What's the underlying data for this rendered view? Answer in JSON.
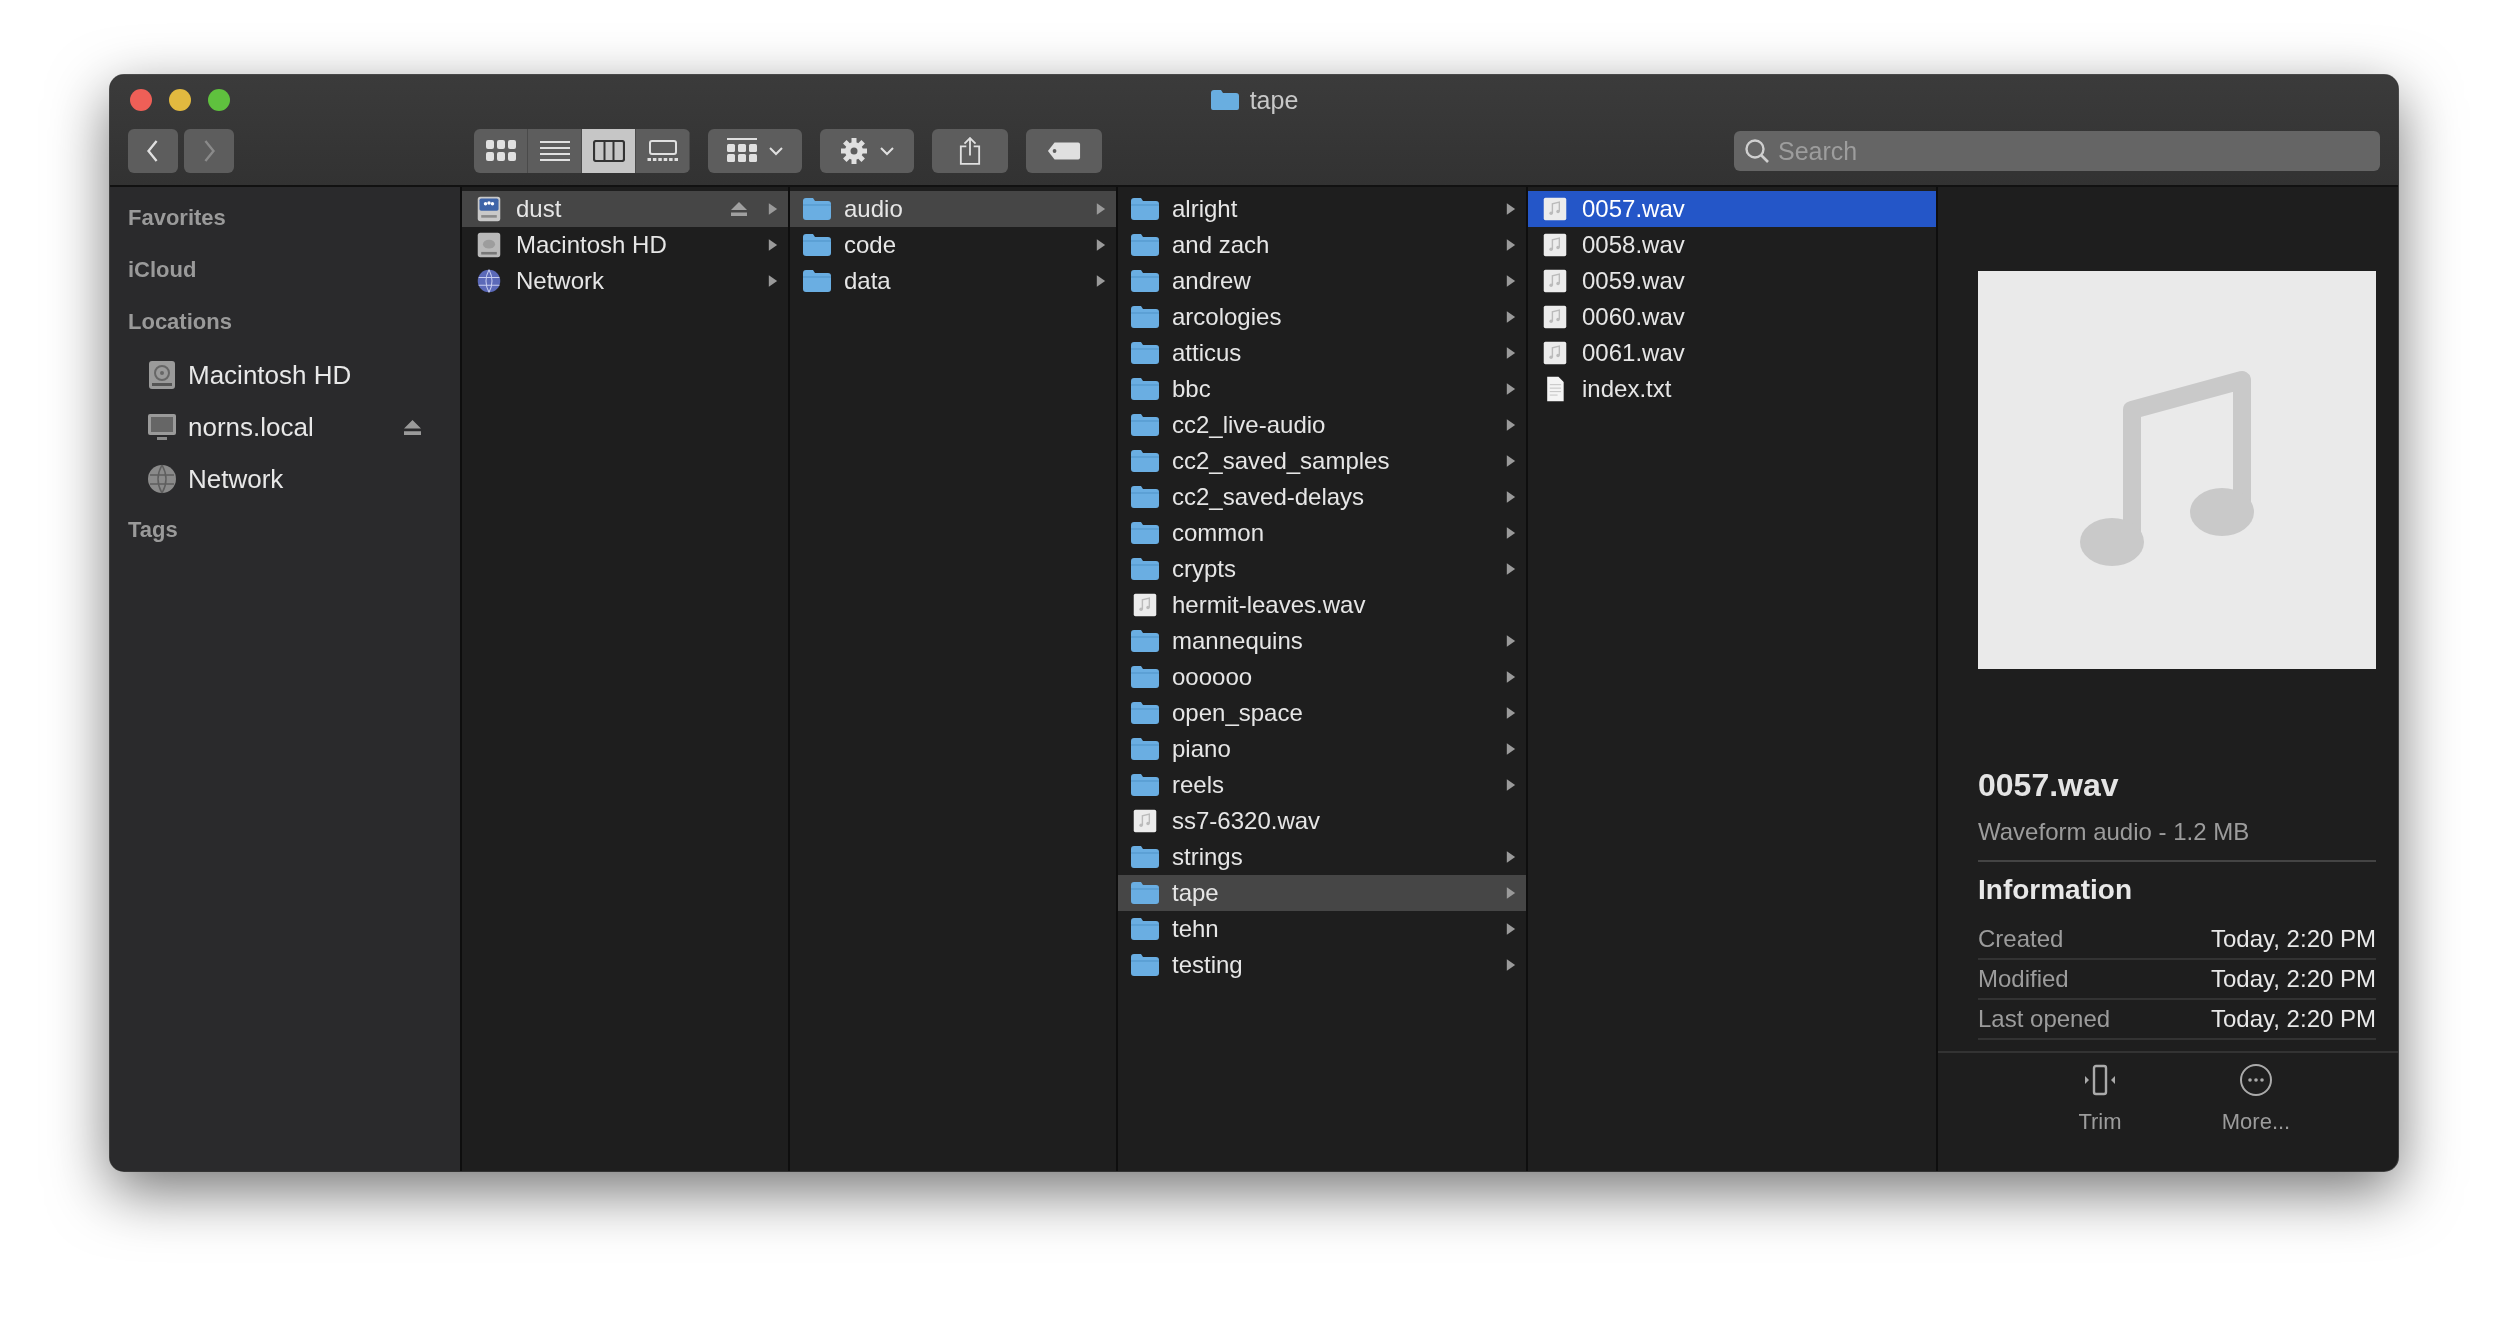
{
  "window": {
    "title": "tape"
  },
  "toolbar": {
    "back": {
      "disabled": false
    },
    "forward": {
      "disabled": true
    },
    "view_modes": [
      {
        "kind": "icons",
        "selected": false
      },
      {
        "kind": "list",
        "selected": false
      },
      {
        "kind": "columns",
        "selected": true
      },
      {
        "kind": "gallery",
        "selected": false
      }
    ],
    "search": {
      "placeholder": "Search"
    }
  },
  "sidebar": {
    "sections": [
      {
        "title": "Favorites"
      },
      {
        "title": "iCloud"
      },
      {
        "title": "Locations",
        "items": [
          {
            "label": "Macintosh HD",
            "kind": "disk",
            "ejectable": false
          },
          {
            "label": "norns.local",
            "kind": "computer",
            "ejectable": true
          },
          {
            "label": "Network",
            "kind": "globe",
            "ejectable": false
          }
        ]
      },
      {
        "title": "Tags"
      }
    ]
  },
  "columns": [
    {
      "active": false,
      "items": [
        {
          "label": "dust",
          "kind": "server",
          "selected": true,
          "ejectable": true,
          "expandable": true
        },
        {
          "label": "Macintosh HD",
          "kind": "disk",
          "selected": false,
          "ejectable": false,
          "expandable": true
        },
        {
          "label": "Network",
          "kind": "globe",
          "selected": false,
          "ejectable": false,
          "expandable": true
        }
      ]
    },
    {
      "active": false,
      "items": [
        {
          "label": "audio",
          "kind": "folder",
          "selected": true,
          "ejectable": false,
          "expandable": true
        },
        {
          "label": "code",
          "kind": "folder",
          "selected": false,
          "ejectable": false,
          "expandable": true
        },
        {
          "label": "data",
          "kind": "folder",
          "selected": false,
          "ejectable": false,
          "expandable": true
        }
      ]
    },
    {
      "active": false,
      "items": [
        {
          "label": "alright",
          "kind": "folder",
          "selected": false,
          "ejectable": false,
          "expandable": true
        },
        {
          "label": "and zach",
          "kind": "folder",
          "selected": false,
          "ejectable": false,
          "expandable": true
        },
        {
          "label": "andrew",
          "kind": "folder",
          "selected": false,
          "ejectable": false,
          "expandable": true
        },
        {
          "label": "arcologies",
          "kind": "folder",
          "selected": false,
          "ejectable": false,
          "expandable": true
        },
        {
          "label": "atticus",
          "kind": "folder",
          "selected": false,
          "ejectable": false,
          "expandable": true
        },
        {
          "label": "bbc",
          "kind": "folder",
          "selected": false,
          "ejectable": false,
          "expandable": true
        },
        {
          "label": "cc2_live-audio",
          "kind": "folder",
          "selected": false,
          "ejectable": false,
          "expandable": true
        },
        {
          "label": "cc2_saved_samples",
          "kind": "folder",
          "selected": false,
          "ejectable": false,
          "expandable": true
        },
        {
          "label": "cc2_saved-delays",
          "kind": "folder",
          "selected": false,
          "ejectable": false,
          "expandable": true
        },
        {
          "label": "common",
          "kind": "folder",
          "selected": false,
          "ejectable": false,
          "expandable": true
        },
        {
          "label": "crypts",
          "kind": "folder",
          "selected": false,
          "ejectable": false,
          "expandable": true
        },
        {
          "label": "hermit-leaves.wav",
          "kind": "audio",
          "selected": false,
          "ejectable": false,
          "expandable": false
        },
        {
          "label": "mannequins",
          "kind": "folder",
          "selected": false,
          "ejectable": false,
          "expandable": true
        },
        {
          "label": "oooooo",
          "kind": "folder",
          "selected": false,
          "ejectable": false,
          "expandable": true
        },
        {
          "label": "open_space",
          "kind": "folder",
          "selected": false,
          "ejectable": false,
          "expandable": true
        },
        {
          "label": "piano",
          "kind": "folder",
          "selected": false,
          "ejectable": false,
          "expandable": true
        },
        {
          "label": "reels",
          "kind": "folder",
          "selected": false,
          "ejectable": false,
          "expandable": true
        },
        {
          "label": "ss7-6320.wav",
          "kind": "audio",
          "selected": false,
          "ejectable": false,
          "expandable": false
        },
        {
          "label": "strings",
          "kind": "folder",
          "selected": false,
          "ejectable": false,
          "expandable": true
        },
        {
          "label": "tape",
          "kind": "folder",
          "selected": true,
          "ejectable": false,
          "expandable": true
        },
        {
          "label": "tehn",
          "kind": "folder",
          "selected": false,
          "ejectable": false,
          "expandable": true
        },
        {
          "label": "testing",
          "kind": "folder",
          "selected": false,
          "ejectable": false,
          "expandable": true
        }
      ]
    },
    {
      "active": true,
      "items": [
        {
          "label": "0057.wav",
          "kind": "audio",
          "selected": true,
          "ejectable": false,
          "expandable": false
        },
        {
          "label": "0058.wav",
          "kind": "audio",
          "selected": false,
          "ejectable": false,
          "expandable": false
        },
        {
          "label": "0059.wav",
          "kind": "audio",
          "selected": false,
          "ejectable": false,
          "expandable": false
        },
        {
          "label": "0060.wav",
          "kind": "audio",
          "selected": false,
          "ejectable": false,
          "expandable": false
        },
        {
          "label": "0061.wav",
          "kind": "audio",
          "selected": false,
          "ejectable": false,
          "expandable": false
        },
        {
          "label": "index.txt",
          "kind": "text",
          "selected": false,
          "ejectable": false,
          "expandable": false
        }
      ]
    }
  ],
  "preview": {
    "name": "0057.wav",
    "subtitle": "Waveform audio - 1.2 MB",
    "section_title": "Information",
    "info": [
      {
        "label": "Created",
        "value": "Today, 2:20 PM"
      },
      {
        "label": "Modified",
        "value": "Today, 2:20 PM"
      },
      {
        "label": "Last opened",
        "value": "Today, 2:20 PM"
      }
    ],
    "actions": [
      {
        "label": "Trim",
        "kind": "trim"
      },
      {
        "label": "More...",
        "kind": "more"
      }
    ]
  }
}
